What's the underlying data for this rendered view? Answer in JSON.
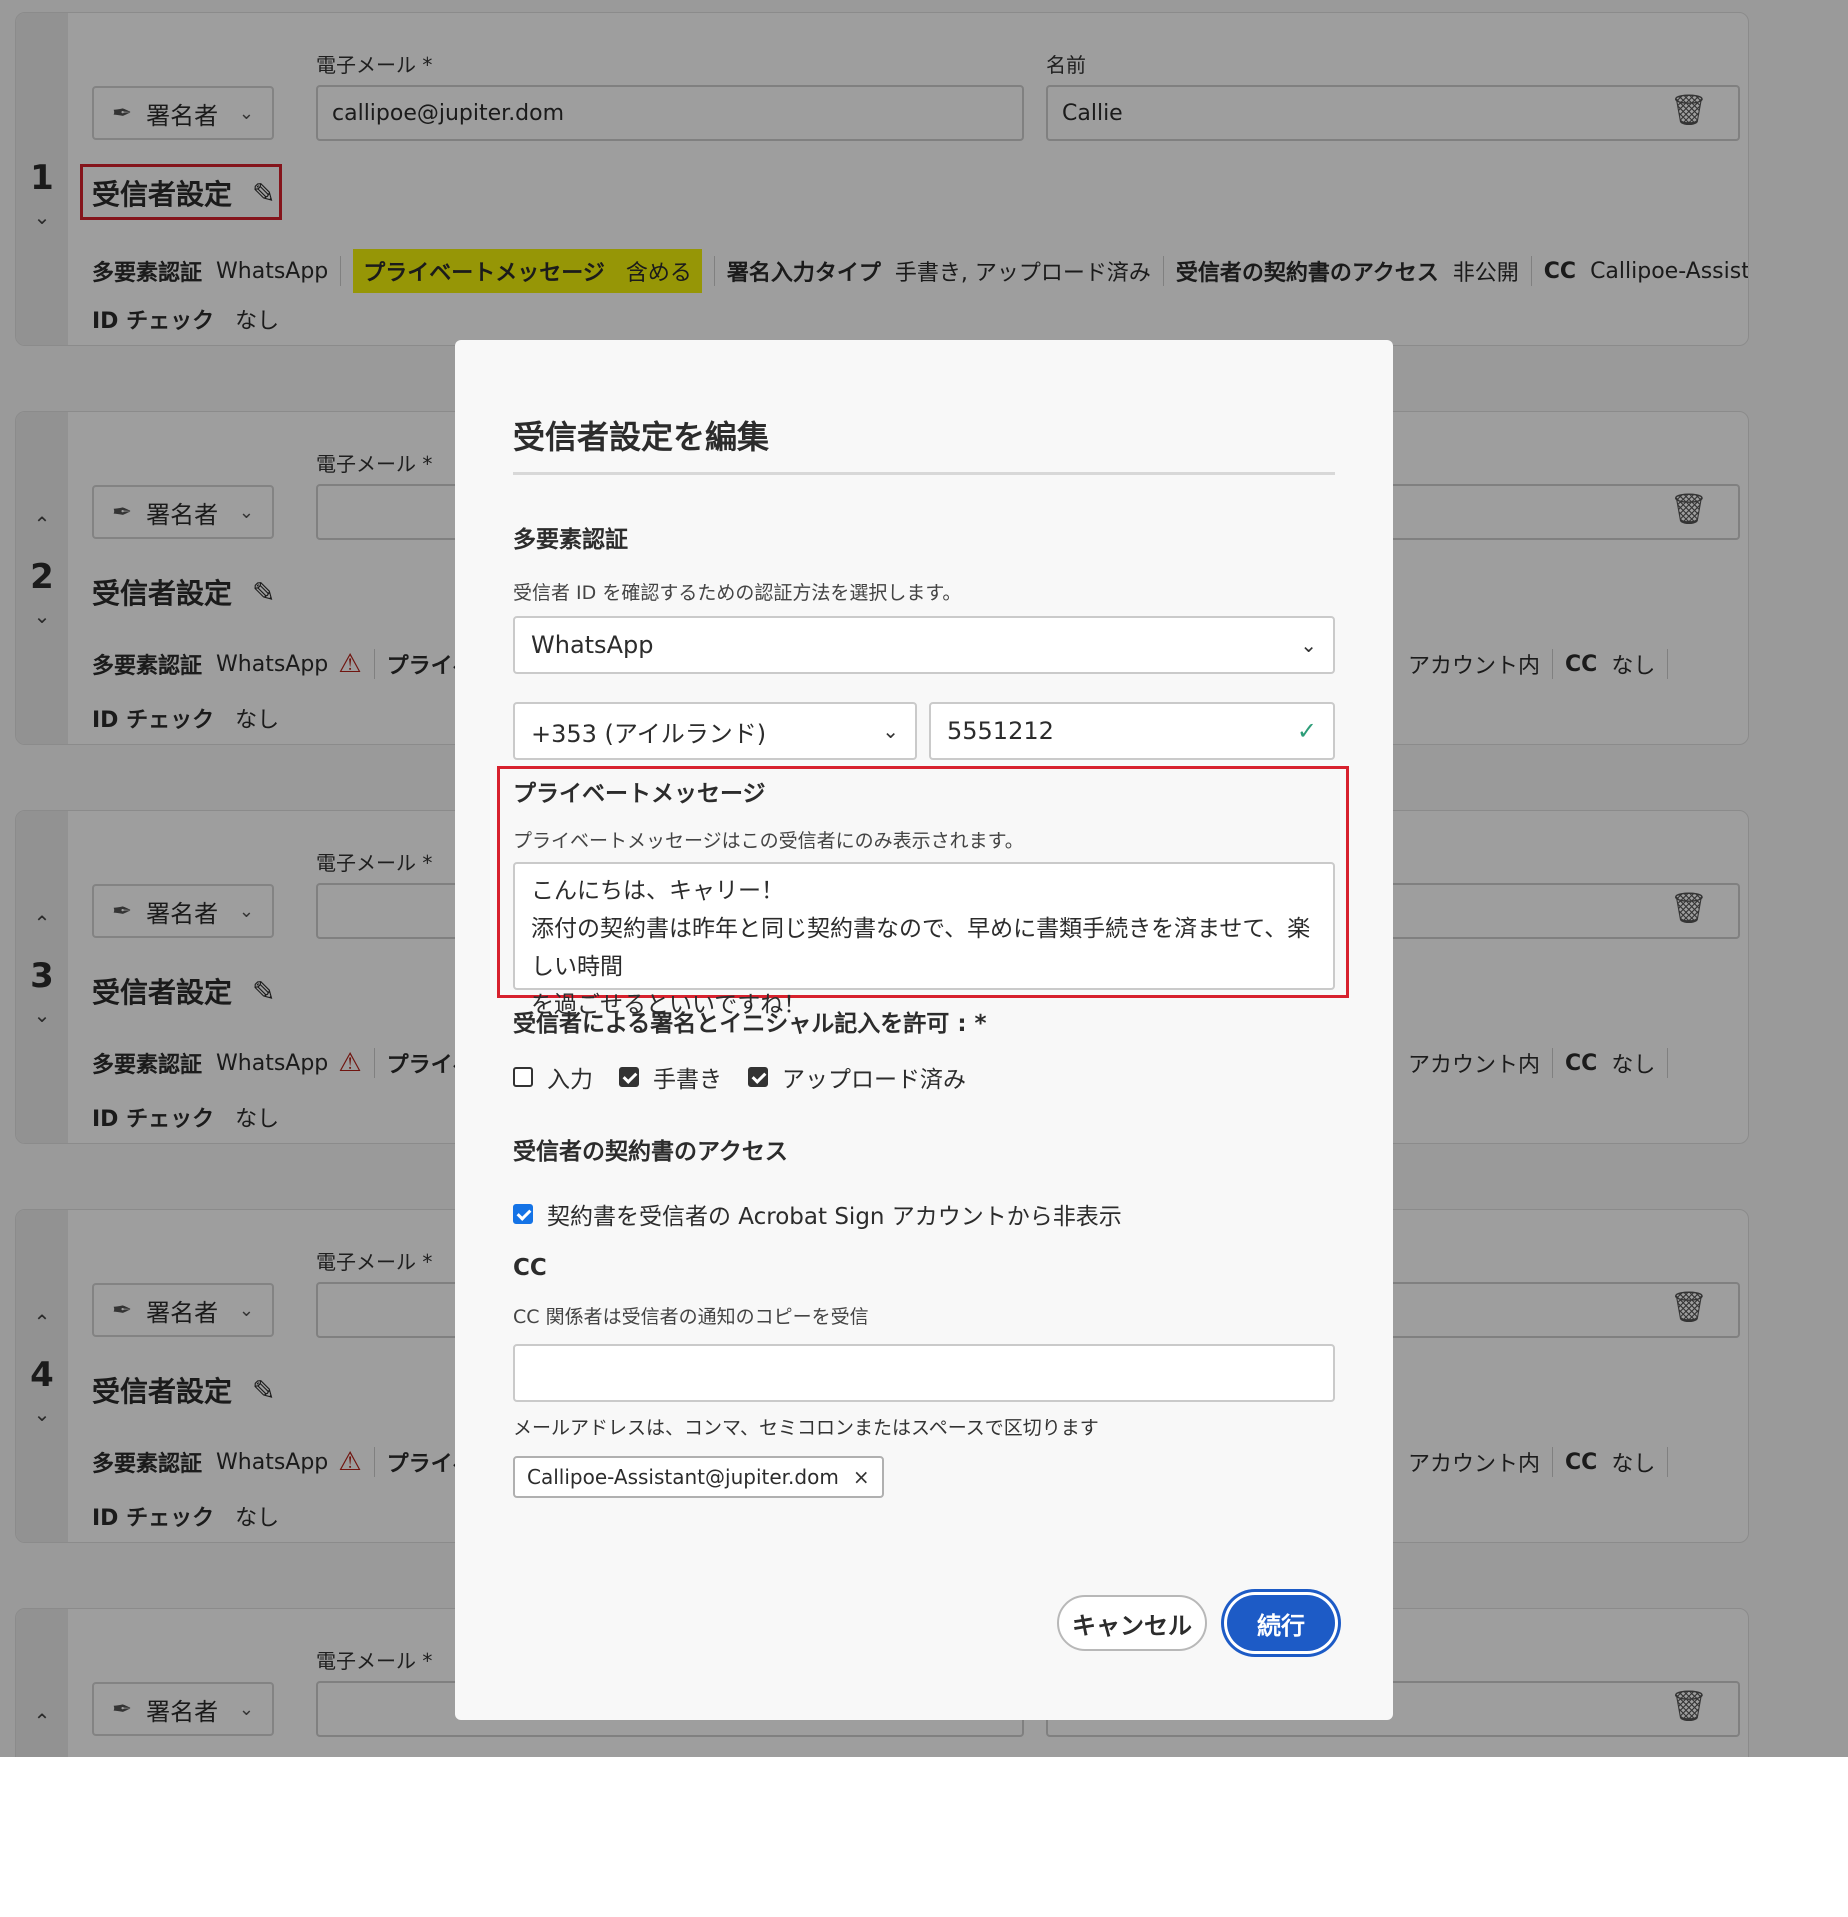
{
  "cards": [
    {
      "num": "1",
      "up": "",
      "down": "⌄",
      "role": "署名者",
      "email_label": "電子メール *",
      "email_value": "callipoe@jupiter.dom",
      "name_label": "名前",
      "name_value": "Callie",
      "settings_label": "受信者設定",
      "mfa_label": "多要素認証",
      "mfa_value": "WhatsApp",
      "pm_label": "プライベートメッセージ",
      "pm_value": "含める",
      "sig_label": "署名入力タイプ",
      "sig_value": "手書き, アップロード済み",
      "access_label": "受信者の契約書のアクセス",
      "access_value": "非公開",
      "cc_label": "CC",
      "cc_value": "Callipoe-Assistant@jupiter.dom",
      "id_label": "ID チェック",
      "id_value": "なし"
    },
    {
      "num": "2",
      "up": "⌃",
      "down": "⌄",
      "role": "署名者",
      "email_label": "電子メール *",
      "settings_label": "受信者設定",
      "mfa_label": "多要素認証",
      "mfa_value": "WhatsApp",
      "pm_partial": "プライベー",
      "access_partial": "アカウント内",
      "cc_label": "CC",
      "cc_value": "なし",
      "id_label": "ID チェック",
      "id_value": "なし"
    },
    {
      "num": "3",
      "up": "⌃",
      "down": "⌄",
      "role": "署名者",
      "email_label": "電子メール *",
      "settings_label": "受信者設定",
      "mfa_label": "多要素認証",
      "mfa_value": "WhatsApp",
      "pm_partial": "プライベー",
      "access_partial": "アカウント内",
      "cc_label": "CC",
      "cc_value": "なし",
      "id_label": "ID チェック",
      "id_value": "なし"
    },
    {
      "num": "4",
      "up": "⌃",
      "down": "⌄",
      "role": "署名者",
      "email_label": "電子メール *",
      "settings_label": "受信者設定",
      "mfa_label": "多要素認証",
      "mfa_value": "WhatsApp",
      "pm_partial": "プライベー",
      "access_partial": "アカウント内",
      "cc_label": "CC",
      "cc_value": "なし",
      "id_label": "ID チェック",
      "id_value": "なし"
    },
    {
      "num": "",
      "up": "⌃",
      "down": "",
      "role": "署名者",
      "email_label": "電子メール *"
    }
  ],
  "modal": {
    "title": "受信者設定を編集",
    "mfa_heading": "多要素認証",
    "mfa_desc": "受信者 ID を確認するための認証方法を選択します。",
    "mfa_select": "WhatsApp",
    "country_select": "+353 (アイルランド)",
    "phone_value": "5551212",
    "pm_heading": "プライベートメッセージ",
    "pm_desc": "プライベートメッセージはこの受信者にのみ表示されます。",
    "pm_lines": [
      "こんにちは、キャリー！",
      "添付の契約書は昨年と同じ契約書なので、早めに書類手続きを済ませて、楽しい時間",
      "を過ごせるといいですね！"
    ],
    "allow_heading": "受信者による署名とイニシャル記入を許可 : *",
    "allow_options": [
      {
        "label": "入力",
        "checked": false
      },
      {
        "label": "手書き",
        "checked": true
      },
      {
        "label": "アップロード済み",
        "checked": true
      }
    ],
    "access_heading": "受信者の契約書のアクセス",
    "access_option": "契約書を受信者の Acrobat Sign アカウントから非表示",
    "cc_heading": "CC",
    "cc_desc": "CC 関係者は受信者の通知のコピーを受信",
    "cc_hint": "メールアドレスは、コンマ、セミコロンまたはスペースで区切ります",
    "cc_tag": "Callipoe-Assistant@jupiter.dom",
    "cancel_label": "キャンセル",
    "continue_label": "続行"
  },
  "colors": {
    "highlight_red": "#d7212d",
    "highlight_yellow": "#f2f20a",
    "primary_blue": "#1d5bc6",
    "check_green": "#2d9d78",
    "warning_red": "#b5231a"
  },
  "icons": [
    "pen-icon",
    "chevron-down-icon",
    "chevron-up-icon",
    "pencil-icon",
    "trash-icon",
    "warning-icon",
    "checkmark-icon",
    "close-icon"
  ]
}
